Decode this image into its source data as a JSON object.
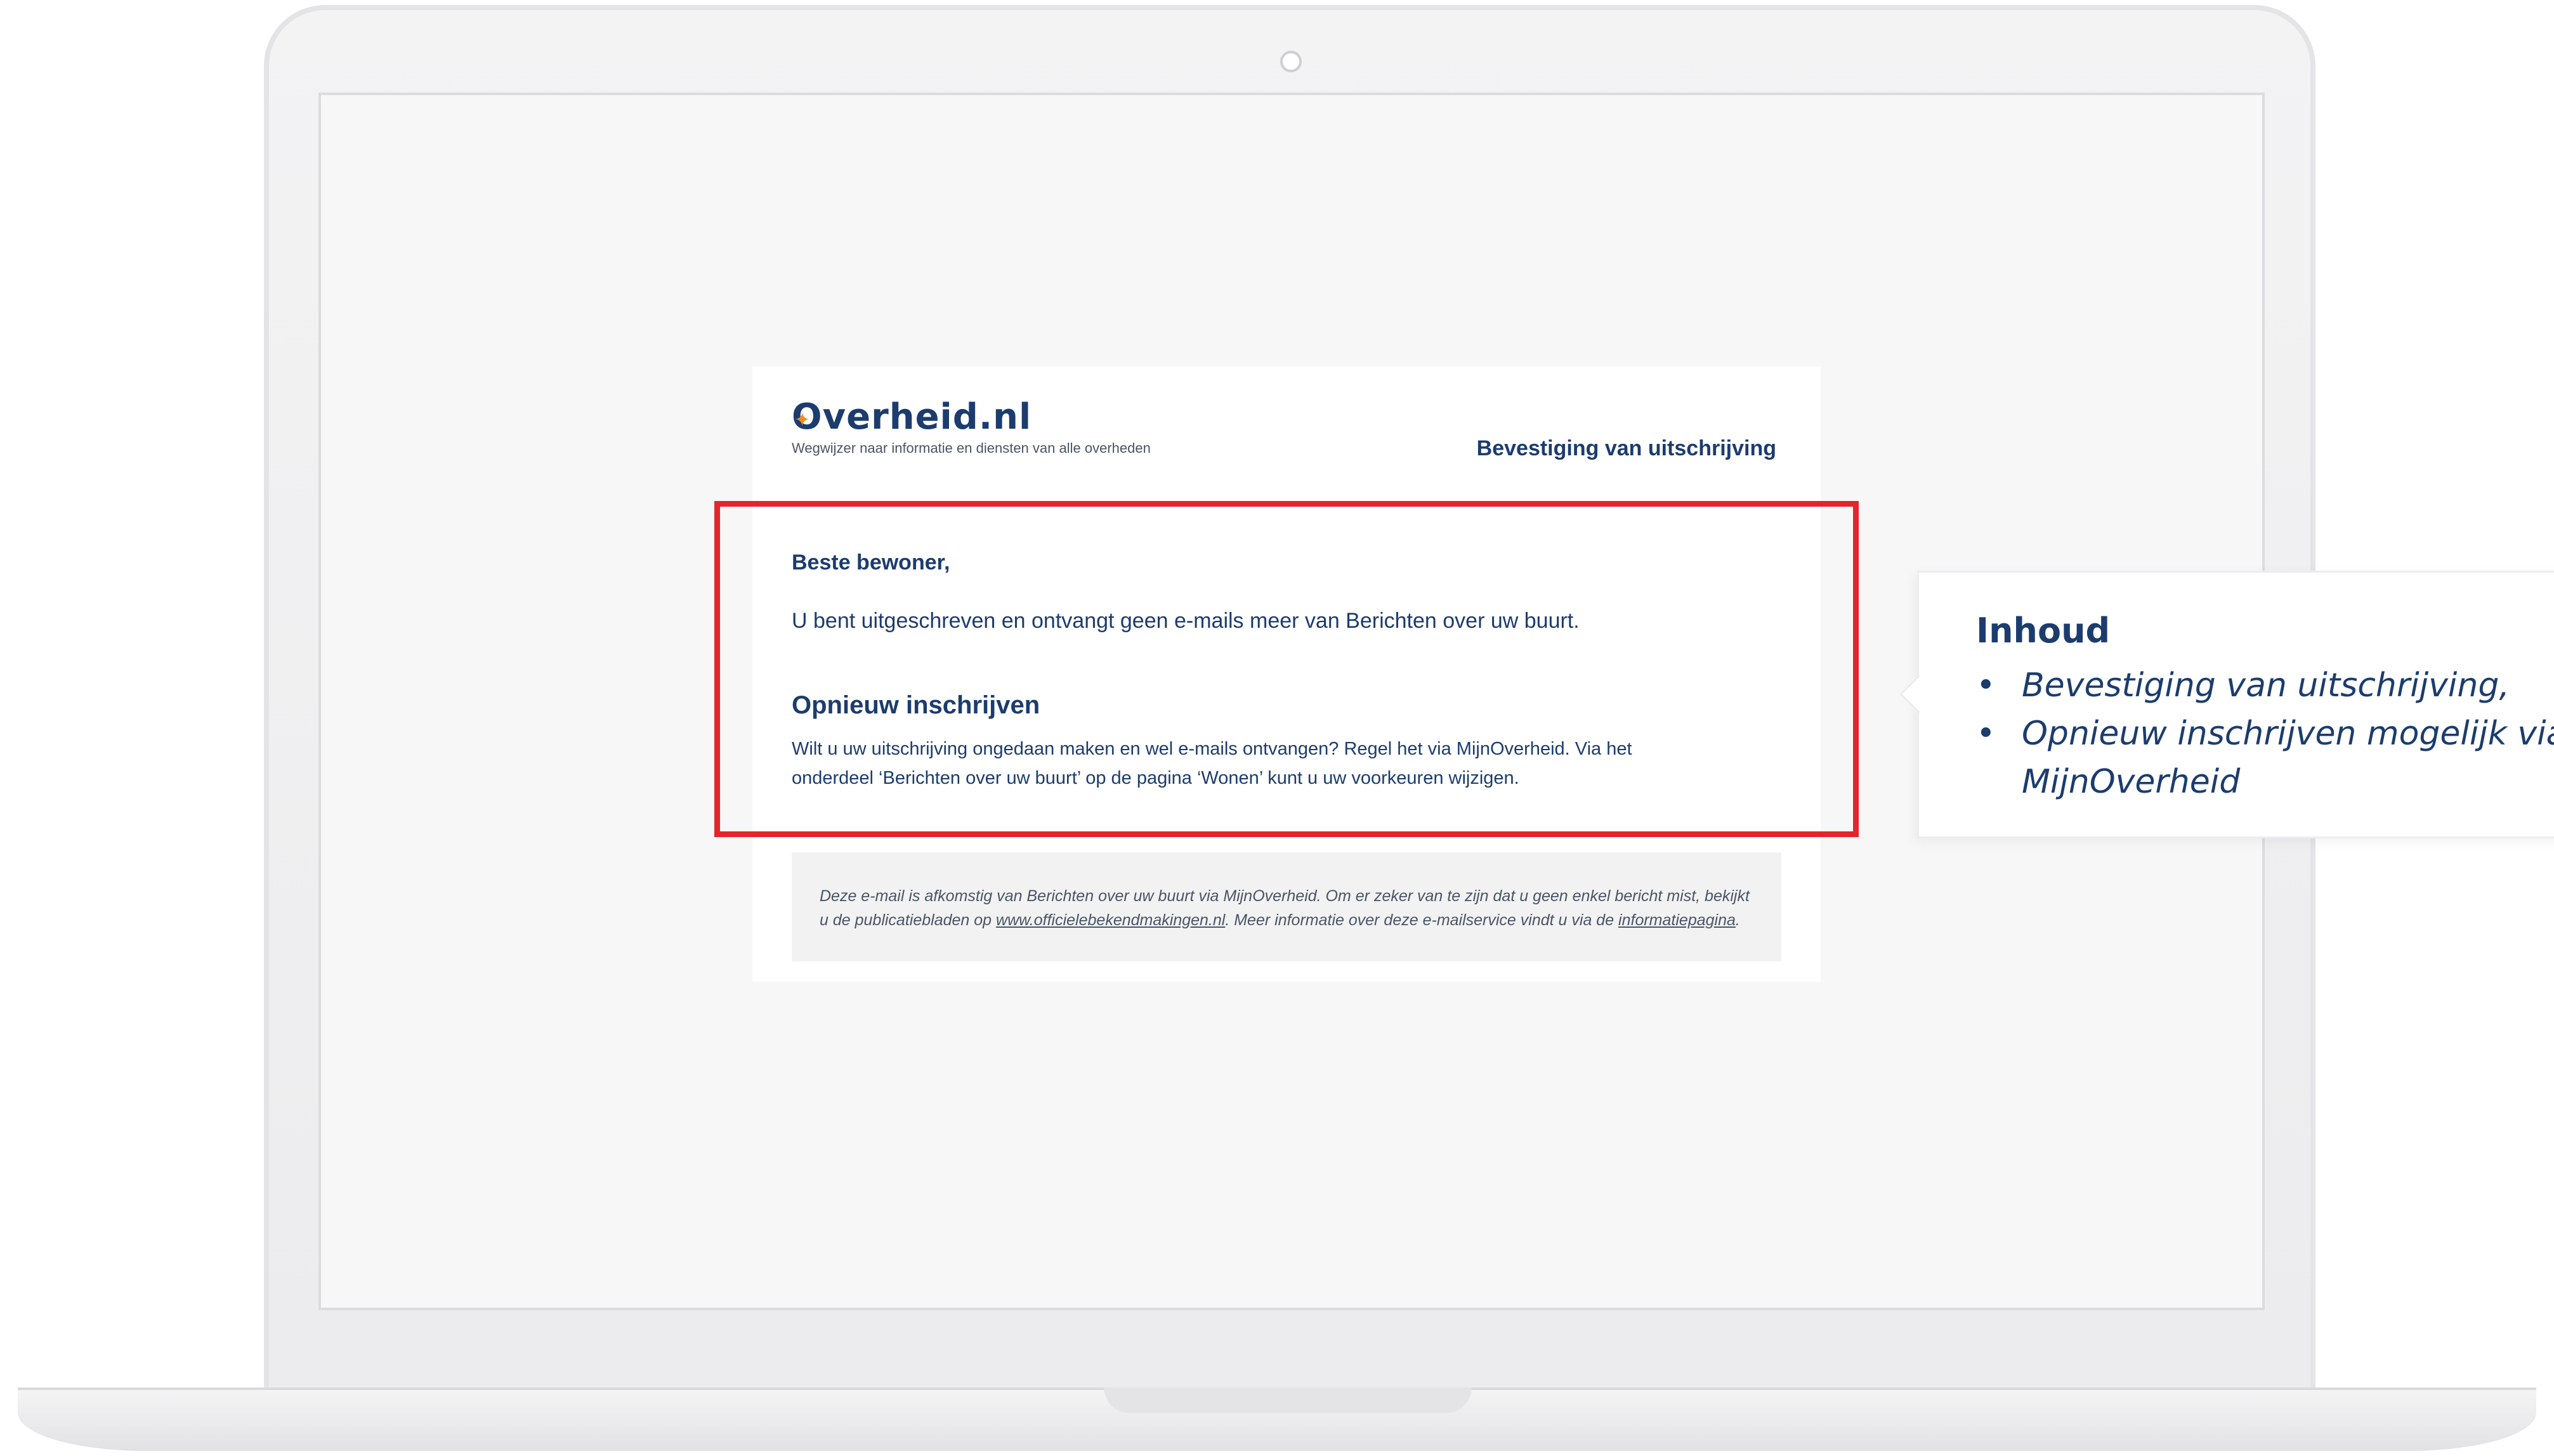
{
  "email": {
    "logo": "Overheid.nl",
    "tagline": "Wegwijzer naar informatie en diensten van alle overheden",
    "subject": "Bevestiging van uitschrijving",
    "greeting": "Beste bewoner,",
    "intro": "U bent uitgeschreven en ontvangt geen e-mails meer van Berichten over uw buurt.",
    "section_heading": "Opnieuw inschrijven",
    "section_text_line1": "Wilt u uw uitschrijving ongedaan maken en wel e-mails ontvangen? Regel het via MijnOverheid. Via het",
    "section_text_line2": "onderdeel ‘Berichten over uw buurt’ op de pagina ‘Wonen’ kunt u uw voorkeuren wijzigen.",
    "footer": {
      "line1": "Deze e-mail is afkomstig van Berichten over uw buurt via MijnOverheid. Om er zeker van te zijn dat u geen enkel bericht mist, bekijkt",
      "line2_prefix": "u de publicatiebladen op ",
      "link1": "www.officielebekendmakingen.nl",
      "line2_middle": ". Meer informatie over deze e-mailservice vindt u via de ",
      "link2": "informatiepagina",
      "line2_suffix": "."
    }
  },
  "callout": {
    "title": "Inhoud",
    "items": [
      "Bevestiging van uitschrijving,",
      "Opnieuw inschrijven mogelijk via MijnOverheid"
    ],
    "bullet": "•"
  },
  "colors": {
    "navy": "#1c3c6e",
    "highlight_border": "#e3262b",
    "logo_accent": "#f08a24"
  }
}
